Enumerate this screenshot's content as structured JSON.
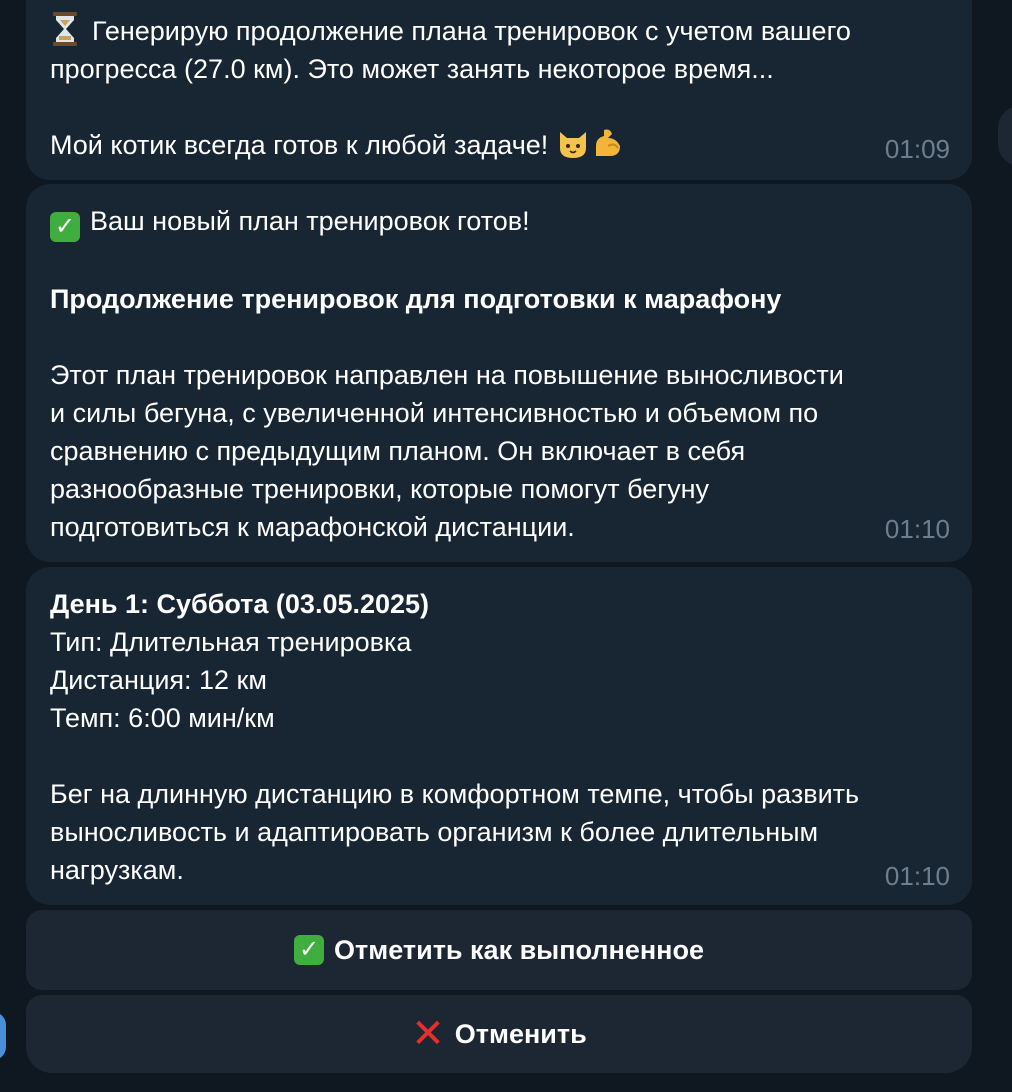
{
  "messages": [
    {
      "line1": "Генерирую продолжение плана тренировок с учетом вашего",
      "line2": "прогресса (27.0 км). Это может занять некоторое время...",
      "line3": "Мой котик всегда готов к любой задаче!",
      "time": "01:09"
    },
    {
      "heading": "Ваш новый план тренировок готов!",
      "title": "Продолжение тренировок для подготовки к марафону",
      "body": "Этот план тренировок направлен на повышение выносливости\nи силы бегуна, с увеличенной интенсивностью и объемом по\nсравнению с предыдущим планом. Он включает в себя\nразнообразные тренировки, которые помогут бегуну\nподготовиться к марафонской дистанции.",
      "time": "01:10"
    },
    {
      "day": "День 1: Суббота (03.05.2025)",
      "type": "Тип: Длительная тренировка",
      "distance": "Дистанция: 12 км",
      "pace": "Темп: 6:00 мин/км",
      "description": "Бег на длинную дистанцию в комфортном темпе, чтобы развить\nвыносливость и адаптировать организм к более длительным\nнагрузкам.",
      "time": "01:10"
    }
  ],
  "keyboard": {
    "done_label": "Отметить как выполненное",
    "cancel_label": "Отменить"
  },
  "icons": {
    "hourglass": "hourglass-icon",
    "cat": "cat-face-icon",
    "muscle": "flexed-biceps-icon",
    "check": "check-mark-button-icon",
    "cross": "cross-mark-icon"
  },
  "colors": {
    "background": "#0f1720",
    "bubble": "#182533",
    "button": "#1c2733",
    "time": "#6d7f8f",
    "check_green": "#3fae3f",
    "cross_red": "#e8302a"
  }
}
